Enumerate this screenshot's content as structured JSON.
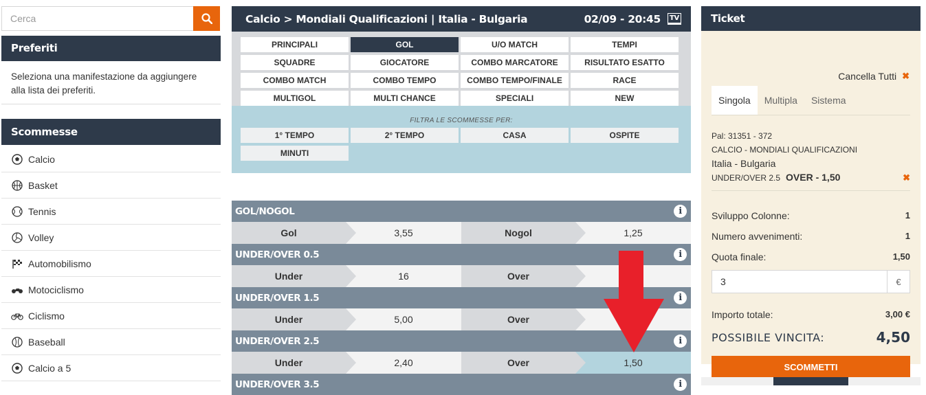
{
  "search": {
    "placeholder": "Cerca"
  },
  "favorites": {
    "title": "Preferiti",
    "text": "Seleziona una manifestazione da aggiungere alla lista dei preferiti."
  },
  "bets_panel": {
    "title": "Scommesse",
    "sports": [
      {
        "label": "Calcio",
        "icon": "soccer-ball-icon"
      },
      {
        "label": "Basket",
        "icon": "basketball-icon"
      },
      {
        "label": "Tennis",
        "icon": "tennis-ball-icon"
      },
      {
        "label": "Volley",
        "icon": "volleyball-icon"
      },
      {
        "label": "Automobilismo",
        "icon": "checkered-flag-icon"
      },
      {
        "label": "Motociclismo",
        "icon": "motorcycle-icon"
      },
      {
        "label": "Ciclismo",
        "icon": "bicycle-icon"
      },
      {
        "label": "Baseball",
        "icon": "baseball-icon"
      },
      {
        "label": "Calcio a 5",
        "icon": "soccer-ball-icon"
      }
    ]
  },
  "match": {
    "title": "Calcio > Mondiali Qualificazioni | Italia - Bulgaria",
    "datetime": "02/09 - 20:45",
    "tv_label": "TV"
  },
  "tabs": [
    "PRINCIPALI",
    "GOL",
    "U/O MATCH",
    "TEMPI",
    "SQUADRE",
    "GIOCATORE",
    "COMBO MARCATORE",
    "RISULTATO ESATTO",
    "COMBO MATCH",
    "COMBO TEMPO",
    "COMBO TEMPO/FINALE",
    "RACE",
    "MULTIGOL",
    "MULTI CHANCE",
    "SPECIALI",
    "NEW"
  ],
  "active_tab": "GOL",
  "filter": {
    "title": "FILTRA LE SCOMMESSE PER:",
    "options": [
      "1° TEMPO",
      "2° TEMPO",
      "CASA",
      "OSPITE",
      "MINUTI"
    ]
  },
  "markets": [
    {
      "title": "GOL/NOGOL",
      "o1_label": "Gol",
      "o1_odd": "3,55",
      "o2_label": "Nogol",
      "o2_odd": "1,25"
    },
    {
      "title": "UNDER/OVER 0.5",
      "o1_label": "Under",
      "o1_odd": "16",
      "o2_label": "Over",
      "o2_odd": ""
    },
    {
      "title": "UNDER/OVER 1.5",
      "o1_label": "Under",
      "o1_odd": "5,00",
      "o2_label": "Over",
      "o2_odd": ""
    },
    {
      "title": "UNDER/OVER 2.5",
      "o1_label": "Under",
      "o1_odd": "2,40",
      "o2_label": "Over",
      "o2_odd": "1,50",
      "selected": "o2"
    },
    {
      "title": "UNDER/OVER 3.5"
    }
  ],
  "ticket": {
    "title": "Ticket",
    "cancel_all": "Cancella Tutti",
    "tabs": [
      "Singola",
      "Multipla",
      "Sistema"
    ],
    "active_tab": "Singola",
    "bet": {
      "pal": "Pal: 31351 - 372",
      "competition": "CALCIO - MONDIALI QUALIFICAZIONI",
      "event": "Italia - Bulgaria",
      "market": "UNDER/OVER 2.5",
      "selection": "OVER - 1,50"
    },
    "sviluppo_label": "Sviluppo Colonne:",
    "sviluppo_value": "1",
    "avvenimenti_label": "Numero avvenimenti:",
    "avvenimenti_value": "1",
    "quota_label": "Quota finale:",
    "quota_value": "1,50",
    "stake": "3",
    "currency": "€",
    "importo_label": "Importo totale:",
    "importo_value": "3,00 €",
    "win_label": "POSSIBILE VINCITA:",
    "win_value": "4,50",
    "bet_button": "SCOMMETTI"
  },
  "colors": {
    "dark": "#2e3a4a",
    "accent": "#e8650c",
    "selected_odd": "#b3d4de",
    "arrow": "#e8202a"
  }
}
